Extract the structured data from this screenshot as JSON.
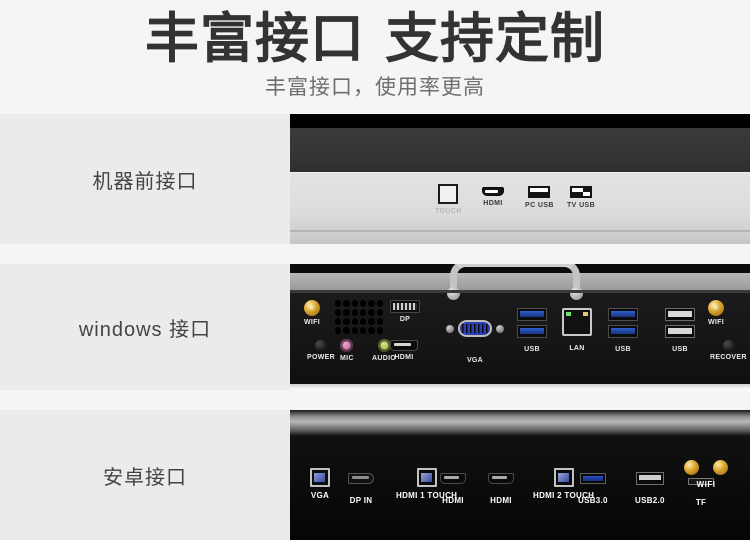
{
  "header": {
    "title_part1": "丰富接口",
    "title_part2": "支持定制",
    "subtitle": "丰富接口，使用率更高"
  },
  "colors": {
    "page_bg": "#f5f5f5",
    "row_bg": "#ebebeb",
    "title_color": "#333333",
    "subtitle_color": "#6e6e6e",
    "label_color": "#444444",
    "usb3_blue": "#2a50c8",
    "mic_pink": "#b5558c",
    "audio_green": "#8ba22f",
    "antenna_gold": "#d9a32b"
  },
  "rows": [
    {
      "label": "机器前接口",
      "ports": [
        {
          "name": "TOUCH",
          "icon": "touch-port-icon"
        },
        {
          "name": "HDMI",
          "icon": "hdmi-port-icon"
        },
        {
          "name": "PC USB",
          "icon": "usb-port-icon"
        },
        {
          "name": "TV USB",
          "icon": "usb-port-icon"
        }
      ]
    },
    {
      "label": "windows 接口",
      "ports": [
        {
          "name": "WIFI",
          "icon": "wifi-antenna-icon"
        },
        {
          "name": "POWER",
          "icon": "power-button-icon"
        },
        {
          "name": "MIC",
          "icon": "mic-jack-icon"
        },
        {
          "name": "AUDIO",
          "icon": "audio-jack-icon"
        },
        {
          "name": "DP",
          "icon": "displayport-icon"
        },
        {
          "name": "HDMI",
          "icon": "hdmi-port-icon"
        },
        {
          "name": "VGA",
          "icon": "vga-port-icon"
        },
        {
          "name": "USB",
          "icon": "usb3-port-icon"
        },
        {
          "name": "LAN",
          "icon": "lan-port-icon"
        },
        {
          "name": "USB",
          "icon": "usb3-port-icon"
        },
        {
          "name": "USB",
          "icon": "usb2-port-icon"
        },
        {
          "name": "RECOVER",
          "icon": "recover-button-icon"
        },
        {
          "name": "WIFI",
          "icon": "wifi-antenna-icon"
        }
      ]
    },
    {
      "label": "安卓接口",
      "ports": [
        {
          "name": "VGA",
          "icon": "vga-port-icon"
        },
        {
          "name": "DP IN",
          "icon": "displayport-icon"
        },
        {
          "name": "HDMI 1\nTOUCH",
          "icon": "hdmi-touch-port-icon"
        },
        {
          "name": "HDMI",
          "icon": "hdmi-port-icon"
        },
        {
          "name": "HDMI",
          "icon": "hdmi-port-icon"
        },
        {
          "name": "HDMI 2\nTOUCH",
          "icon": "hdmi-touch-port-icon"
        },
        {
          "name": "USB3.0",
          "icon": "usb3-port-icon"
        },
        {
          "name": "USB2.0",
          "icon": "usb2-port-icon"
        },
        {
          "name": "TF",
          "icon": "tf-card-slot-icon"
        },
        {
          "name": "WIFI",
          "icon": "wifi-antenna-icon"
        }
      ]
    }
  ]
}
